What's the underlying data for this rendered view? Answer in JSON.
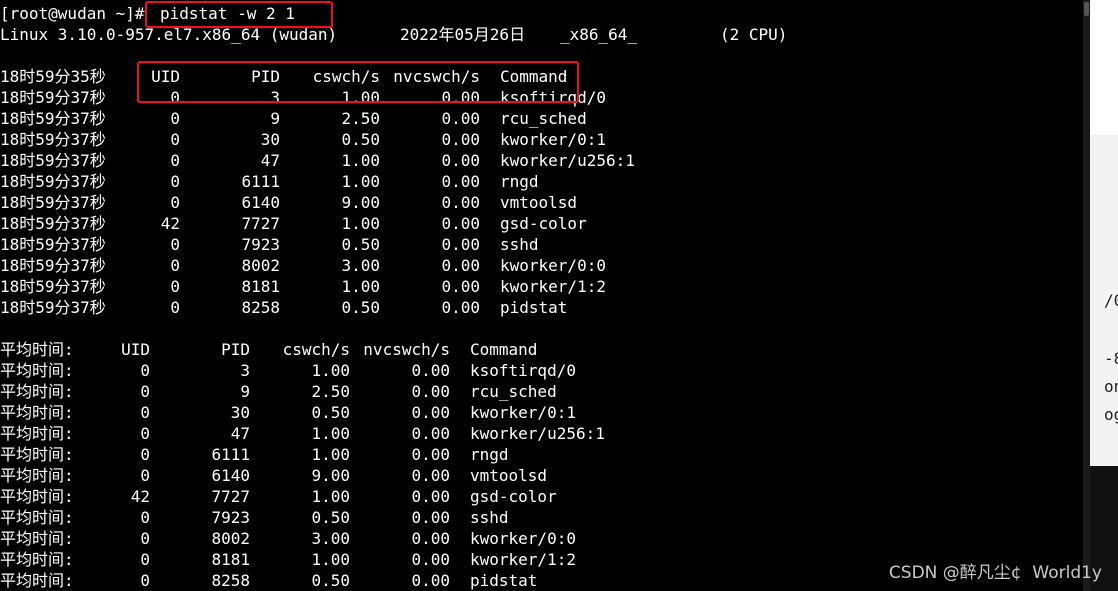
{
  "terminal": {
    "prompt": "[root@wudan ~]# ",
    "command": "pidstat -w 2 1",
    "sysinfo": {
      "kernel": "Linux 3.10.0-957.el7.x86_64 (wudan)",
      "date": "2022年05月26日",
      "arch": "_x86_64_",
      "cpus": "(2 CPU)"
    },
    "sample": {
      "header": {
        "time": "18时59分35秒",
        "uid": "UID",
        "pid": "PID",
        "cswch": "cswch/s",
        "nvcswch": "nvcswch/s",
        "command": "Command"
      },
      "rows": [
        {
          "time": "18时59分37秒",
          "uid": "0",
          "pid": "3",
          "cswch": "1.00",
          "nvcswch": "0.00",
          "command": "ksoftirqd/0"
        },
        {
          "time": "18时59分37秒",
          "uid": "0",
          "pid": "9",
          "cswch": "2.50",
          "nvcswch": "0.00",
          "command": "rcu_sched"
        },
        {
          "time": "18时59分37秒",
          "uid": "0",
          "pid": "30",
          "cswch": "0.50",
          "nvcswch": "0.00",
          "command": "kworker/0:1"
        },
        {
          "time": "18时59分37秒",
          "uid": "0",
          "pid": "47",
          "cswch": "1.00",
          "nvcswch": "0.00",
          "command": "kworker/u256:1"
        },
        {
          "time": "18时59分37秒",
          "uid": "0",
          "pid": "6111",
          "cswch": "1.00",
          "nvcswch": "0.00",
          "command": "rngd"
        },
        {
          "time": "18时59分37秒",
          "uid": "0",
          "pid": "6140",
          "cswch": "9.00",
          "nvcswch": "0.00",
          "command": "vmtoolsd"
        },
        {
          "time": "18时59分37秒",
          "uid": "42",
          "pid": "7727",
          "cswch": "1.00",
          "nvcswch": "0.00",
          "command": "gsd-color"
        },
        {
          "time": "18时59分37秒",
          "uid": "0",
          "pid": "7923",
          "cswch": "0.50",
          "nvcswch": "0.00",
          "command": "sshd"
        },
        {
          "time": "18时59分37秒",
          "uid": "0",
          "pid": "8002",
          "cswch": "3.00",
          "nvcswch": "0.00",
          "command": "kworker/0:0"
        },
        {
          "time": "18时59分37秒",
          "uid": "0",
          "pid": "8181",
          "cswch": "1.00",
          "nvcswch": "0.00",
          "command": "kworker/1:2"
        },
        {
          "time": "18时59分37秒",
          "uid": "0",
          "pid": "8258",
          "cswch": "0.50",
          "nvcswch": "0.00",
          "command": "pidstat"
        }
      ]
    },
    "average": {
      "header": {
        "time": "平均时间:",
        "uid": "UID",
        "pid": "PID",
        "cswch": "cswch/s",
        "nvcswch": "nvcswch/s",
        "command": "Command"
      },
      "rows": [
        {
          "time": "平均时间:",
          "uid": "0",
          "pid": "3",
          "cswch": "1.00",
          "nvcswch": "0.00",
          "command": "ksoftirqd/0"
        },
        {
          "time": "平均时间:",
          "uid": "0",
          "pid": "9",
          "cswch": "2.50",
          "nvcswch": "0.00",
          "command": "rcu_sched"
        },
        {
          "time": "平均时间:",
          "uid": "0",
          "pid": "30",
          "cswch": "0.50",
          "nvcswch": "0.00",
          "command": "kworker/0:1"
        },
        {
          "time": "平均时间:",
          "uid": "0",
          "pid": "47",
          "cswch": "1.00",
          "nvcswch": "0.00",
          "command": "kworker/u256:1"
        },
        {
          "time": "平均时间:",
          "uid": "0",
          "pid": "6111",
          "cswch": "1.00",
          "nvcswch": "0.00",
          "command": "rngd"
        },
        {
          "time": "平均时间:",
          "uid": "0",
          "pid": "6140",
          "cswch": "9.00",
          "nvcswch": "0.00",
          "command": "vmtoolsd"
        },
        {
          "time": "平均时间:",
          "uid": "42",
          "pid": "7727",
          "cswch": "1.00",
          "nvcswch": "0.00",
          "command": "gsd-color"
        },
        {
          "time": "平均时间:",
          "uid": "0",
          "pid": "7923",
          "cswch": "0.50",
          "nvcswch": "0.00",
          "command": "sshd"
        },
        {
          "time": "平均时间:",
          "uid": "0",
          "pid": "8002",
          "cswch": "3.00",
          "nvcswch": "0.00",
          "command": "kworker/0:0"
        },
        {
          "time": "平均时间:",
          "uid": "0",
          "pid": "8181",
          "cswch": "1.00",
          "nvcswch": "0.00",
          "command": "kworker/1:2"
        },
        {
          "time": "平均时间:",
          "uid": "0",
          "pid": "8258",
          "cswch": "0.50",
          "nvcswch": "0.00",
          "command": "pidstat"
        }
      ]
    }
  },
  "background_window": {
    "fragments": [
      "/0",
      "-8",
      "on",
      "og"
    ]
  },
  "watermark": "CSDN @醉凡尘¢  World1y",
  "colors": {
    "terminal_bg": "#000000",
    "terminal_fg": "#ffffff",
    "highlight": "#e8141b",
    "watermark": "#c9c9c9"
  }
}
